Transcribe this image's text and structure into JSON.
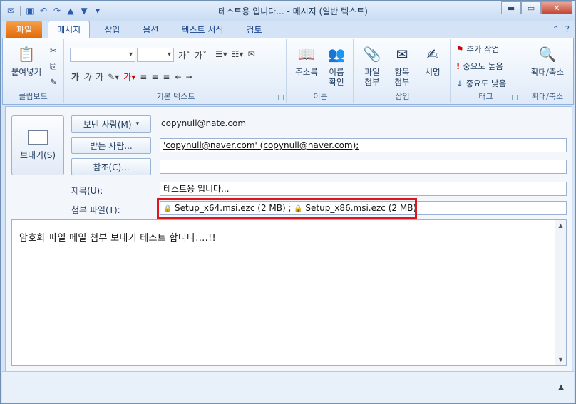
{
  "window": {
    "title": "테스트용 입니다... - 메시지 (일반 텍스트)",
    "controls": {
      "minimize": "▬",
      "maximize": "▭",
      "close": "✕"
    }
  },
  "qat": [
    "app-icon",
    "save-icon",
    "undo-icon",
    "redo-icon",
    "up-icon",
    "down-icon",
    "customize-icon"
  ],
  "tabs": [
    {
      "label": "파일",
      "kind": "file"
    },
    {
      "label": "메시지",
      "kind": "active"
    },
    {
      "label": "삽입"
    },
    {
      "label": "옵션"
    },
    {
      "label": "텍스트 서식"
    },
    {
      "label": "검토"
    }
  ],
  "ribbon": {
    "clipboard": {
      "label": "클립보드",
      "paste": "붙여넣기"
    },
    "basic_text": {
      "label": "기본 텍스트"
    },
    "names": {
      "label": "이름",
      "address_book": "주소록",
      "check_names_1": "이름",
      "check_names_2": "확인"
    },
    "include": {
      "label": "삽입",
      "attach_file_1": "파일",
      "attach_file_2": "첨부",
      "attach_item_1": "항목",
      "attach_item_2": "첨부",
      "signature": "서명"
    },
    "tags": {
      "label": "태그",
      "follow_up": "추가 작업",
      "high_importance": "중요도 높음",
      "low_importance": "중요도 낮음"
    },
    "zoom": {
      "label": "확대/축소",
      "zoom_btn": "확대/축소"
    }
  },
  "compose": {
    "send": "보내기(S)",
    "from_button": "보낸 사람(M)",
    "from_value": "copynull@nate.com",
    "to_button": "받는 사람...",
    "to_value": "'copynull@naver.com' (copynull@naver.com);",
    "cc_button": "참조(C)...",
    "cc_value": "",
    "subject_label": "제목(U):",
    "subject_value": "테스트용 입니다...",
    "attach_label": "첨부 파일(T):",
    "attachments": [
      "Setup_x64.msi.ezc (2 MB)",
      "Setup_x86.msi.ezc (2 MB)"
    ],
    "attachment_sep": ";",
    "body": "암호화 파일 메일 첨부 보내기 테스트 합니다....!!"
  },
  "colors": {
    "accent_file_tab": "#e26b0a",
    "highlight_box": "#e0141c"
  }
}
